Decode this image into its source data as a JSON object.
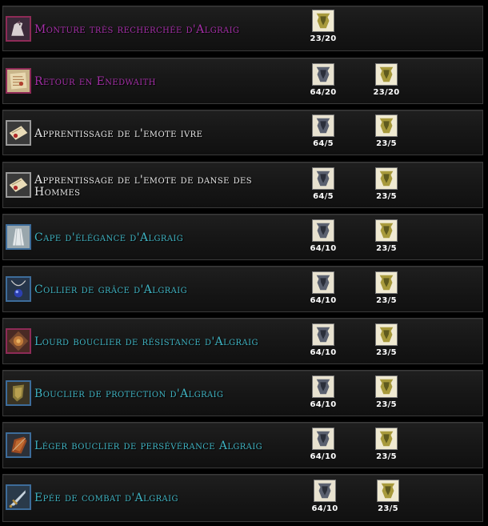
{
  "colors": {
    "epic": "#a52fa8",
    "common": "#e6e6e6",
    "rare": "#3fb3c2",
    "token_dark": "#5b6170",
    "token_gold": "#a89a3c"
  },
  "items": [
    {
      "name": "Monture très recherchée d'Algraig",
      "quality": "epic",
      "icon": "horse-mount-icon",
      "costs": [
        {
          "token": "gold-token-icon",
          "value": "23/20"
        }
      ]
    },
    {
      "name": "Retour en Enedwaith",
      "quality": "epic",
      "icon": "map-scroll-icon",
      "costs": [
        {
          "token": "dark-token-icon",
          "value": "64/20"
        },
        {
          "token": "gold-token-icon",
          "value": "23/20"
        }
      ]
    },
    {
      "name": "Apprentissage de l'emote ivre",
      "quality": "common",
      "icon": "emote-scroll-icon",
      "costs": [
        {
          "token": "dark-token-icon",
          "value": "64/5"
        },
        {
          "token": "gold-token-icon",
          "value": "23/5"
        }
      ]
    },
    {
      "name": "Apprentissage de l'emote de danse des Hommes",
      "quality": "common",
      "icon": "emote-scroll-icon",
      "costs": [
        {
          "token": "dark-token-icon",
          "value": "64/5"
        },
        {
          "token": "gold-token-icon",
          "value": "23/5"
        }
      ]
    },
    {
      "name": "Cape d'élégance d'Algraig",
      "quality": "rare",
      "icon": "cloak-icon",
      "costs": [
        {
          "token": "dark-token-icon",
          "value": "64/10"
        },
        {
          "token": "gold-token-icon",
          "value": "23/5"
        }
      ]
    },
    {
      "name": "Collier de grâce d'Algraig",
      "quality": "rare",
      "icon": "necklace-icon",
      "costs": [
        {
          "token": "dark-token-icon",
          "value": "64/10"
        },
        {
          "token": "gold-token-icon",
          "value": "23/5"
        }
      ]
    },
    {
      "name": "Lourd bouclier de résistance d'Algraig",
      "quality": "rare",
      "icon": "heavy-shield-icon",
      "costs": [
        {
          "token": "dark-token-icon",
          "value": "64/10"
        },
        {
          "token": "gold-token-icon",
          "value": "23/5"
        }
      ]
    },
    {
      "name": "Bouclier de protection d'Algraig",
      "quality": "rare",
      "icon": "shield-icon",
      "costs": [
        {
          "token": "dark-token-icon",
          "value": "64/10"
        },
        {
          "token": "gold-token-icon",
          "value": "23/5"
        }
      ]
    },
    {
      "name": "Léger bouclier de persévérance Algraig",
      "quality": "rare",
      "icon": "light-shield-icon",
      "costs": [
        {
          "token": "dark-token-icon",
          "value": "64/10"
        },
        {
          "token": "gold-token-icon",
          "value": "23/5"
        }
      ]
    },
    {
      "name": "Epée de combat d'Algraig",
      "quality": "rare",
      "icon": "sword-icon",
      "costs": [
        {
          "token": "dark-token-icon",
          "value": "64/10"
        },
        {
          "token": "gold-token-icon",
          "value": "23/5"
        }
      ]
    }
  ]
}
